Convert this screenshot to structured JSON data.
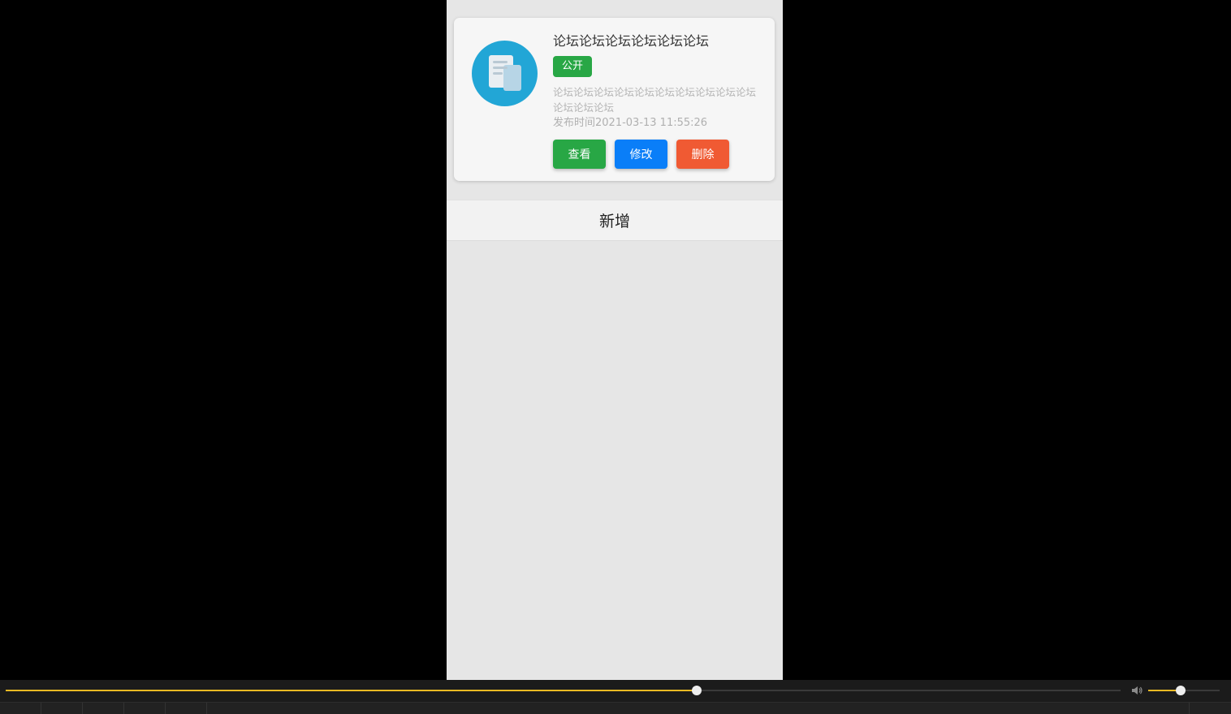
{
  "post": {
    "title": "论坛论坛论坛论坛论坛论坛",
    "status_badge": "公开",
    "description": "论坛论坛论坛论坛论坛论坛论坛论坛论坛论坛论坛论坛论坛",
    "publish_time": "发布时间2021-03-13 11:55:26",
    "icon": "document-icon",
    "actions": {
      "view_label": "查看",
      "edit_label": "修改",
      "delete_label": "删除"
    }
  },
  "add_label": "新增",
  "player": {
    "progress_fraction": 0.62,
    "volume_fraction": 0.45,
    "accent_color": "#e8b923"
  },
  "colors": {
    "avatar": "#22a6d6",
    "badge": "#28a745",
    "view": "#28a745",
    "edit": "#0a7ef8",
    "delete": "#f05a33"
  }
}
